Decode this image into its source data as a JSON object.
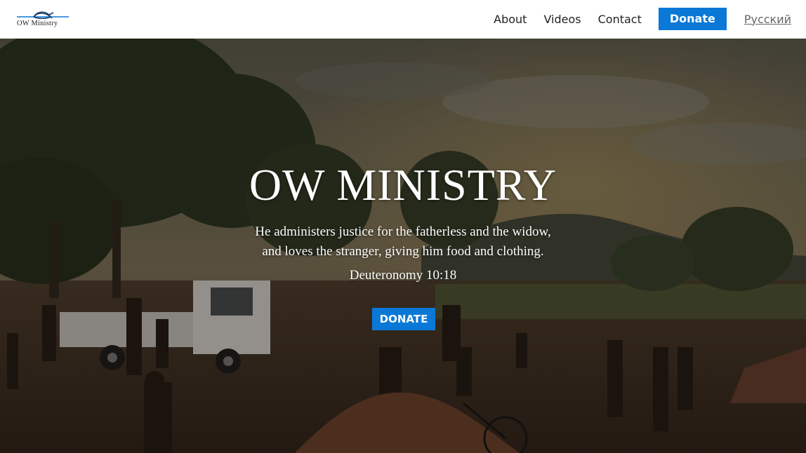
{
  "header": {
    "logo_text": "OW Ministry",
    "nav": {
      "about": "About",
      "videos": "Videos",
      "contact": "Contact",
      "donate": "Donate",
      "language": "Русский"
    }
  },
  "hero": {
    "title": "OW MINISTRY",
    "quote_line1": "He administers justice for the fatherless and the widow,",
    "quote_line2": "and loves the stranger, giving him food and clothing.",
    "reference": "Deuteronomy 10:18",
    "donate_button": "DONATE"
  },
  "colors": {
    "accent": "#0a78d7",
    "header_bg": "#ffffff",
    "nav_text": "#222222",
    "language_link": "#666666"
  },
  "icons": {
    "logo": "ichthys-fish-logo-icon"
  }
}
